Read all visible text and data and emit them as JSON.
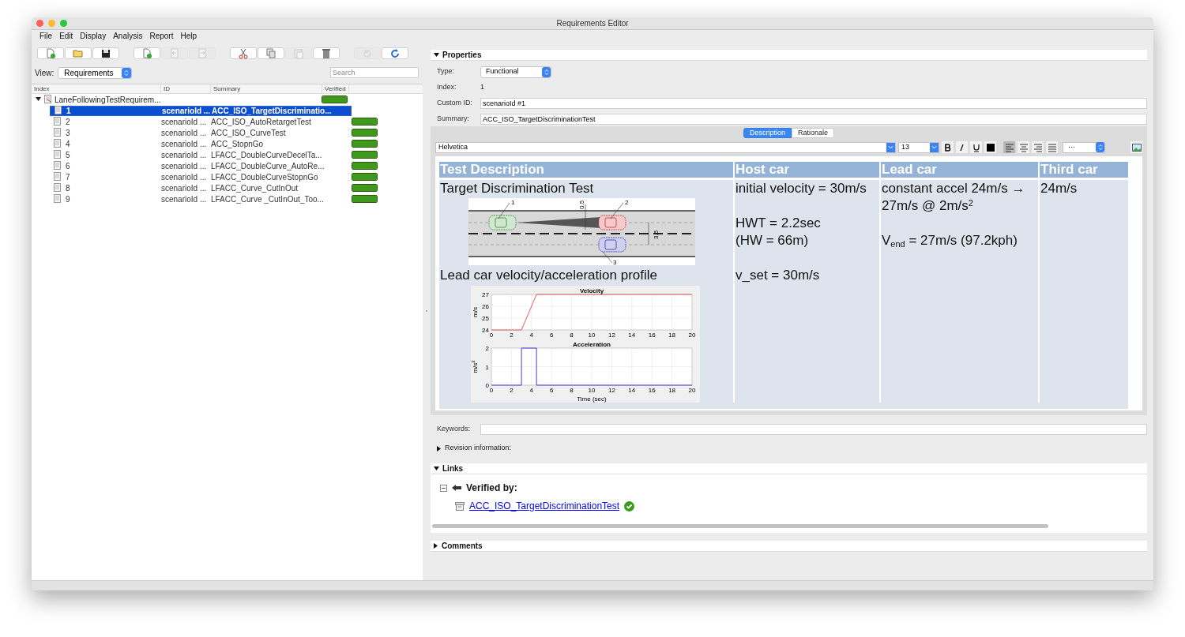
{
  "window": {
    "title": "Requirements Editor"
  },
  "menu": [
    "File",
    "Edit",
    "Display",
    "Analysis",
    "Report",
    "Help"
  ],
  "toolbar": [
    {
      "kind": "new",
      "disabled": false
    },
    {
      "kind": "open",
      "disabled": false
    },
    {
      "kind": "save",
      "disabled": false
    },
    {
      "kind": "separator"
    },
    {
      "kind": "add",
      "disabled": false
    },
    {
      "kind": "outdent",
      "disabled": true
    },
    {
      "kind": "indent",
      "disabled": true
    },
    {
      "kind": "separator"
    },
    {
      "kind": "cut",
      "disabled": false
    },
    {
      "kind": "copy",
      "disabled": false
    },
    {
      "kind": "paste",
      "disabled": true
    },
    {
      "kind": "delete",
      "disabled": false
    },
    {
      "kind": "separator"
    },
    {
      "kind": "verify",
      "disabled": true
    },
    {
      "kind": "refresh",
      "disabled": false
    }
  ],
  "view": {
    "label": "View:",
    "value": "Requirements"
  },
  "search": {
    "placeholder": "Search"
  },
  "tree": {
    "columns": [
      "Index",
      "ID",
      "Summary",
      "Verified"
    ],
    "root": {
      "label": "LaneFollowingTestRequirem...",
      "expanded": true,
      "level": 1,
      "children": [
        {
          "index": "1",
          "id": "scenarioId ...",
          "summary": "ACC_ISO_TargetDiscriminatio...",
          "selected": true
        },
        {
          "index": "2",
          "id": "scenarioId ...",
          "summary": "ACC_ISO_AutoRetargetTest",
          "selected": false,
          "level": 1
        },
        {
          "index": "3",
          "id": "scenarioId ...",
          "summary": "ACC_ISO_CurveTest",
          "selected": false,
          "level": 1
        },
        {
          "index": "4",
          "id": "scenarioId ...",
          "summary": "ACC_StopnGo",
          "selected": false,
          "level": 1
        },
        {
          "index": "5",
          "id": "scenarioId ...",
          "summary": "LFACC_DoubleCurveDecelTa...",
          "selected": false,
          "level": 1
        },
        {
          "index": "6",
          "id": "scenarioId ...",
          "summary": "LFACC_DoubleCurve_AutoRe...",
          "selected": false,
          "level": 1
        },
        {
          "index": "7",
          "id": "scenarioId ...",
          "summary": "LFACC_DoubleCurveStopnGo",
          "selected": false,
          "level": 1
        },
        {
          "index": "8",
          "id": "scenarioId ...",
          "summary": "LFACC_Curve_CutInOut",
          "selected": false,
          "level": 1
        },
        {
          "index": "9",
          "id": "scenarioId ...",
          "summary": "LFACC_Curve _CutInOut_Too...",
          "selected": false,
          "level": 1
        }
      ]
    }
  },
  "properties": {
    "title": "Properties",
    "expanded": true,
    "type": {
      "label": "Type:",
      "value": "Functional"
    },
    "index": {
      "label": "Index:",
      "value": "1"
    },
    "custom_id": {
      "label": "Custom ID:",
      "value": "scenarioId #1"
    },
    "summary": {
      "label": "Summary:",
      "value": "ACC_ISO_TargetDiscriminationTest"
    },
    "tabs": [
      {
        "label": "Description",
        "selected": true
      },
      {
        "label": "Rationale",
        "selected": false
      }
    ],
    "editor_toolbar": {
      "font": "Helvetica",
      "size": "13",
      "more": "···"
    },
    "table": {
      "columns": [
        "Test Description",
        "Host car",
        "Lead car",
        "Third car"
      ],
      "rows": [
        {
          "cells": [
            {
              "kind": "scenario",
              "paragraphs": [
                [
                  "Target Discrimination Test"
                ]
              ],
              "diagram_labels": [
                "1",
                "2",
                "3",
                "0.5",
                "3.5"
              ]
            },
            {
              "kind": "text",
              "paragraphs": [
                [
                  "initial velocity = 30m/s"
                ],
                [
                  "HWT = 2.2sec",
                  "(HW = 66m)"
                ]
              ]
            },
            {
              "kind": "text",
              "paragraphs": [
                [
                  "constant accel 24m/s → 27m/s @ 2m/s$^{2}$"
                ],
                [
                  "V$_{end}$ = 27m/s (97.2kph)"
                ]
              ]
            },
            {
              "kind": "text",
              "paragraphs": [
                [
                  "24m/s"
                ]
              ]
            }
          ]
        },
        {
          "cells": [
            {
              "kind": "plots",
              "paragraphs": [
                [
                  "Lead car velocity/acceleration profile"
                ]
              ],
              "plots": [
                {
                  "chart_data": {
                    "type": "line",
                    "title": "Velocity",
                    "ylabel": "m/s",
                    "x": [
                      0,
                      3,
                      4.5,
                      20
                    ],
                    "series": [
                      {
                        "color": "#e06060",
                        "values": [
                          24,
                          24,
                          27,
                          27
                        ]
                      }
                    ],
                    "xlim": [
                      0,
                      20
                    ],
                    "ylim": [
                      24,
                      27
                    ],
                    "xticks": [
                      0,
                      2,
                      4,
                      6,
                      8,
                      10,
                      12,
                      14,
                      16,
                      18,
                      20
                    ],
                    "yticks": [
                      24,
                      25,
                      26,
                      27
                    ],
                    "grid": true
                  }
                },
                {
                  "chart_data": {
                    "type": "line",
                    "title": "Acceleration",
                    "xlabel": "Time (sec)",
                    "ylabel": "m/s$^{2}$",
                    "x": [
                      0,
                      3,
                      3,
                      4.5,
                      4.5,
                      20
                    ],
                    "series": [
                      {
                        "color": "#4040e0",
                        "values": [
                          0,
                          0,
                          2,
                          2,
                          0,
                          0
                        ]
                      }
                    ],
                    "xlim": [
                      0,
                      20
                    ],
                    "ylim": [
                      0,
                      2
                    ],
                    "xticks": [
                      0,
                      2,
                      4,
                      6,
                      8,
                      10,
                      12,
                      14,
                      16,
                      18,
                      20
                    ],
                    "yticks": [
                      0,
                      1,
                      2
                    ],
                    "grid": true
                  }
                }
              ]
            },
            {
              "kind": "text",
              "paragraphs": [
                [
                  "v_set = 30m/s"
                ]
              ]
            },
            {
              "kind": "text"
            },
            {
              "kind": "text"
            }
          ]
        }
      ]
    }
  },
  "keywords": {
    "label": "Keywords:"
  },
  "revision": {
    "title": "Revision information:",
    "expanded": false
  },
  "links": {
    "title": "Links",
    "expanded": true,
    "group": {
      "label": "Verified by:",
      "expanded": true
    },
    "items": [
      {
        "label": "ACC_ISO_TargetDiscriminationTest",
        "verified": true
      }
    ]
  },
  "comments": {
    "title": "Comments",
    "expanded": false
  }
}
